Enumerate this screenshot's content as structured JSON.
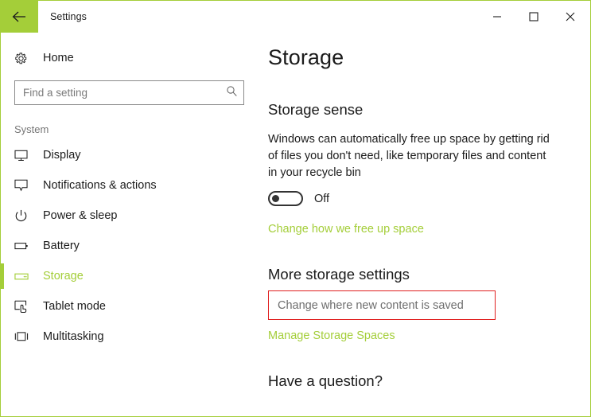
{
  "window": {
    "title": "Settings",
    "back_icon": "back-arrow-icon",
    "controls": {
      "minimize": "minimize-icon",
      "maximize": "maximize-icon",
      "close": "close-icon"
    },
    "accent_color": "#A4CE39",
    "border_color": "#A4CE39"
  },
  "sidebar": {
    "home": {
      "label": "Home",
      "icon": "gear-icon"
    },
    "search": {
      "placeholder": "Find a setting",
      "value": "",
      "icon": "search-icon"
    },
    "section_label": "System",
    "items": [
      {
        "label": "Display",
        "icon": "monitor-icon",
        "selected": false
      },
      {
        "label": "Notifications & actions",
        "icon": "speech-bubble-icon",
        "selected": false
      },
      {
        "label": "Power & sleep",
        "icon": "power-icon",
        "selected": false
      },
      {
        "label": "Battery",
        "icon": "battery-icon",
        "selected": false
      },
      {
        "label": "Storage",
        "icon": "drive-icon",
        "selected": true
      },
      {
        "label": "Tablet mode",
        "icon": "tablet-hand-icon",
        "selected": false
      },
      {
        "label": "Multitasking",
        "icon": "multitasking-icon",
        "selected": false
      }
    ]
  },
  "main": {
    "page_title": "Storage",
    "storage_sense": {
      "heading": "Storage sense",
      "description": "Windows can automatically free up space by getting rid of files you don't need, like temporary files and content in your recycle bin",
      "toggle_state": "Off",
      "link": "Change how we free up space"
    },
    "more_storage": {
      "heading": "More storage settings",
      "highlighted_link": "Change where new content is saved",
      "highlight_color": "#E02020",
      "link": "Manage Storage Spaces"
    },
    "help": {
      "heading": "Have a question?"
    }
  }
}
